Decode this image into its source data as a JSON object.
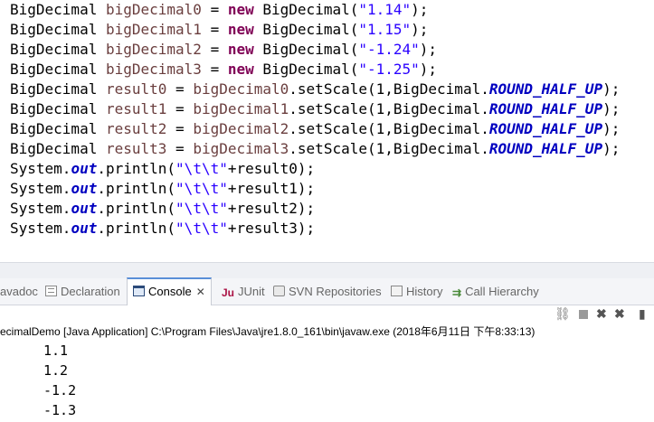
{
  "editor": {
    "lines": [
      {
        "type": "decl",
        "cls": "BigDecimal",
        "var": "bigDecimal0",
        "kw": "new",
        "ctor": "BigDecimal",
        "str": "\"1.14\""
      },
      {
        "type": "decl",
        "cls": "BigDecimal",
        "var": "bigDecimal1",
        "kw": "new",
        "ctor": "BigDecimal",
        "str": "\"1.15\""
      },
      {
        "type": "decl",
        "cls": "BigDecimal",
        "var": "bigDecimal2",
        "kw": "new",
        "ctor": "BigDecimal",
        "str": "\"-1.24\""
      },
      {
        "type": "decl",
        "cls": "BigDecimal",
        "var": "bigDecimal3",
        "kw": "new",
        "ctor": "BigDecimal",
        "str": "\"-1.25\""
      },
      {
        "type": "scale",
        "cls": "BigDecimal",
        "var": "result0",
        "src": "bigDecimal0",
        "method": ".setScale(1,BigDecimal.",
        "const": "ROUND_HALF_UP"
      },
      {
        "type": "scale",
        "cls": "BigDecimal",
        "var": "result1",
        "src": "bigDecimal1",
        "method": ".setScale(1,BigDecimal.",
        "const": "ROUND_HALF_UP"
      },
      {
        "type": "scale",
        "cls": "BigDecimal",
        "var": "result2",
        "src": "bigDecimal2",
        "method": ".setScale(1,BigDecimal.",
        "const": "ROUND_HALF_UP"
      },
      {
        "type": "scale",
        "cls": "BigDecimal",
        "var": "result3",
        "src": "bigDecimal3",
        "method": ".setScale(1,BigDecimal.",
        "const": "ROUND_HALF_UP"
      },
      {
        "type": "print",
        "obj": "System.",
        "field": "out",
        "call": ".println(",
        "str": "\"\\t\\t\"",
        "tail": "+result0);"
      },
      {
        "type": "print",
        "obj": "System.",
        "field": "out",
        "call": ".println(",
        "str": "\"\\t\\t\"",
        "tail": "+result1);"
      },
      {
        "type": "print",
        "obj": "System.",
        "field": "out",
        "call": ".println(",
        "str": "\"\\t\\t\"",
        "tail": "+result2);"
      },
      {
        "type": "print",
        "obj": "System.",
        "field": "out",
        "call": ".println(",
        "str": "\"\\t\\t\"",
        "tail": "+result3);"
      }
    ]
  },
  "tabs": {
    "javadoc": "avadoc",
    "declaration": "Declaration",
    "console": "Console",
    "console_close": "✕",
    "junit": "JUnit",
    "svn": "SVN Repositories",
    "history": "History",
    "call_hierarchy": "Call Hierarchy"
  },
  "console": {
    "header": "ecimalDemo [Java Application] C:\\Program Files\\Java\\jre1.8.0_161\\bin\\javaw.exe (2018年6月11日 下午8:33:13)",
    "output": [
      "1.1",
      "1.2",
      "-1.2",
      "-1.3"
    ]
  },
  "colors": {
    "keyword": "#7f0055",
    "string": "#2a00ff",
    "local_var": "#6a3e3e",
    "static_field": "#0000c0"
  },
  "icons": {
    "declaration": "declaration-icon",
    "console": "console-icon",
    "junit": "junit-icon",
    "svn": "svn-icon",
    "history": "history-icon",
    "call_hierarchy": "call-hierarchy-icon"
  }
}
